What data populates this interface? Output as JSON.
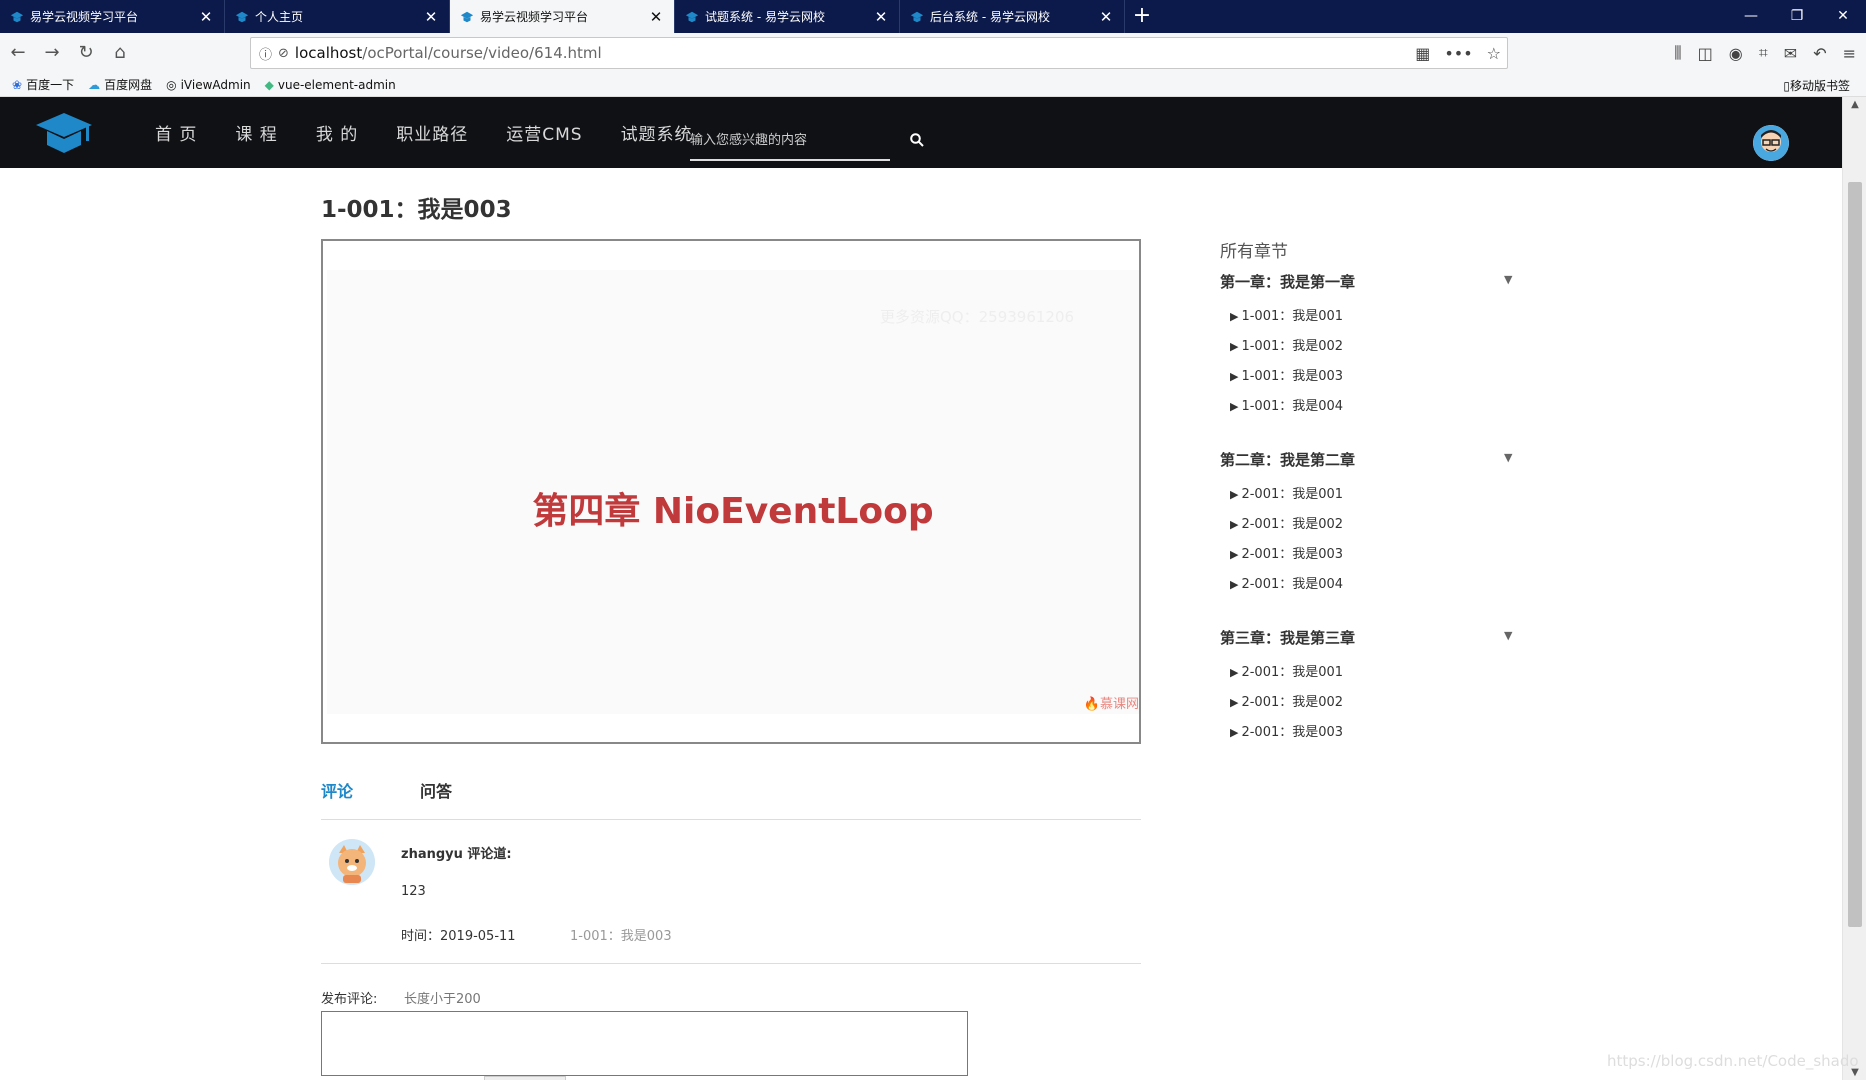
{
  "browser": {
    "tabs": [
      {
        "title": "易学云视频学习平台",
        "active": false
      },
      {
        "title": "个人主页",
        "active": false
      },
      {
        "title": "易学云视频学习平台",
        "active": true
      },
      {
        "title": "试题系统 - 易学云网校",
        "active": false
      },
      {
        "title": "后台系统 - 易学云网校",
        "active": false
      }
    ],
    "url_host": "localhost",
    "url_path": "/ocPortal/course/video/614.html",
    "bookmarks": [
      {
        "label": "百度一下",
        "icon": "paw-icon"
      },
      {
        "label": "百度网盘",
        "icon": "cloud-icon"
      },
      {
        "label": "iViewAdmin",
        "icon": "globe-icon"
      },
      {
        "label": "vue-element-admin",
        "icon": "leaf-icon"
      }
    ],
    "mobile_bookmarks": "移动版书签",
    "tab_bar_color": "#0c1a4b"
  },
  "site": {
    "nav": [
      "首 页",
      "课 程",
      "我 的",
      "职业路径",
      "运营CMS",
      "试题系统"
    ],
    "search_placeholder": "输入您感兴趣的内容",
    "header_color": "#0f1115",
    "accent_color": "#1e88c9"
  },
  "lesson": {
    "title": "1-001：我是003",
    "video_chapter_text": "第四章 NioEventLoop",
    "video_watermark": "更多资源QQ：2593961206",
    "video_brand": "慕课网"
  },
  "content_tabs": [
    "评论",
    "问答"
  ],
  "comment": {
    "author": "zhangyu 评论道:",
    "body": "123",
    "time": "时间：2019-05-11",
    "ref": "1-001：我是003"
  },
  "post": {
    "label": "发布评论:",
    "hint": "长度小于200"
  },
  "sidebar": {
    "title": "所有章节",
    "chapters": [
      {
        "name": "第一章：我是第一章",
        "lessons": [
          "1-001：我是001",
          "1-001：我是002",
          "1-001：我是003",
          "1-001：我是004"
        ]
      },
      {
        "name": "第二章：我是第二章",
        "lessons": [
          "2-001：我是001",
          "2-001：我是002",
          "2-001：我是003",
          "2-001：我是004"
        ]
      },
      {
        "name": "第三章：我是第三章",
        "lessons": [
          "2-001：我是001",
          "2-001：我是002",
          "2-001：我是003"
        ]
      }
    ]
  },
  "csdn_watermark": "https://blog.csdn.net/Code_shado"
}
